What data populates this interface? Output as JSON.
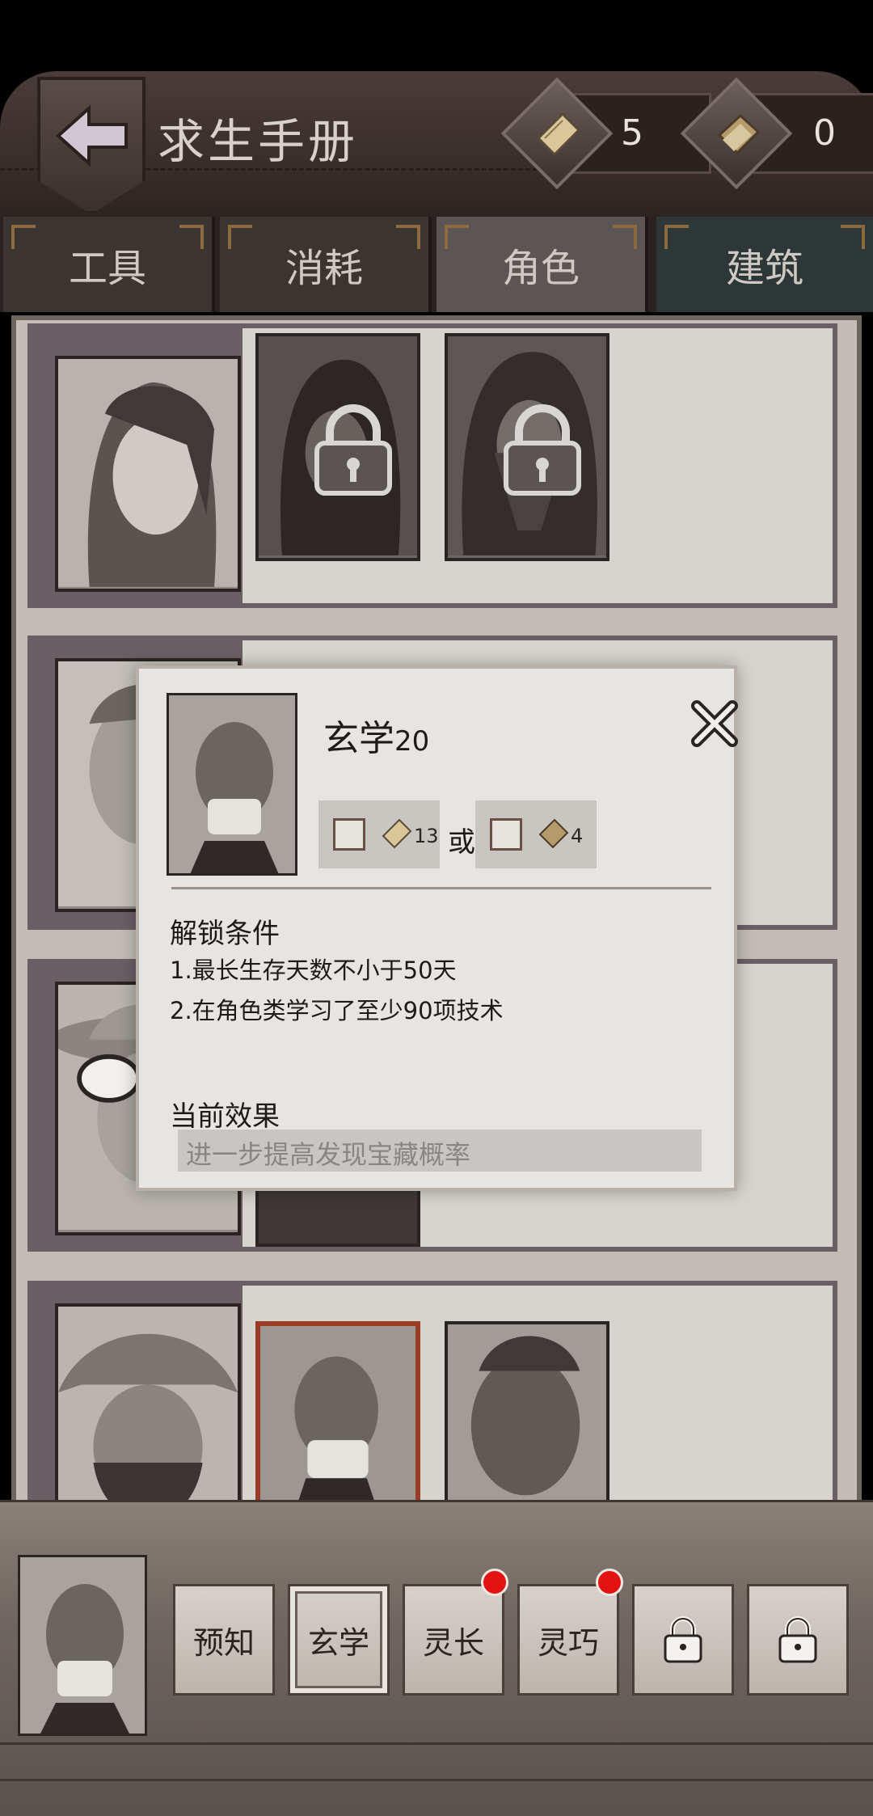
{
  "header": {
    "title": "求生手册",
    "currencies": [
      {
        "icon": "scroll-icon",
        "value": "5"
      },
      {
        "icon": "book-icon",
        "value": "0"
      }
    ]
  },
  "tabs": [
    {
      "label": "工具"
    },
    {
      "label": "消耗"
    },
    {
      "label": "角色",
      "active": true
    },
    {
      "label": "建筑"
    }
  ],
  "popup": {
    "name": "玄学",
    "level": "20",
    "cost_a": "13",
    "or_label": "或",
    "cost_b": "4",
    "unlock_title": "解锁条件",
    "unlock_lines": [
      "1.最长生存天数不小于50天",
      "2.在角色类学习了至少90项技术"
    ],
    "effect_title": "当前效果",
    "effect_text": "进一步提高发现宝藏概率"
  },
  "skills": [
    {
      "label": "预知",
      "locked": false,
      "badge": false
    },
    {
      "label": "玄学",
      "locked": false,
      "badge": false,
      "active": true
    },
    {
      "label": "灵长",
      "locked": false,
      "badge": true
    },
    {
      "label": "灵巧",
      "locked": false,
      "badge": true
    },
    {
      "label": "",
      "locked": true,
      "badge": false
    },
    {
      "label": "",
      "locked": true,
      "badge": false
    }
  ],
  "colors": {
    "badge": "#e31313",
    "selected_border": "#9b3a25",
    "active_tab": "#5b5653"
  }
}
